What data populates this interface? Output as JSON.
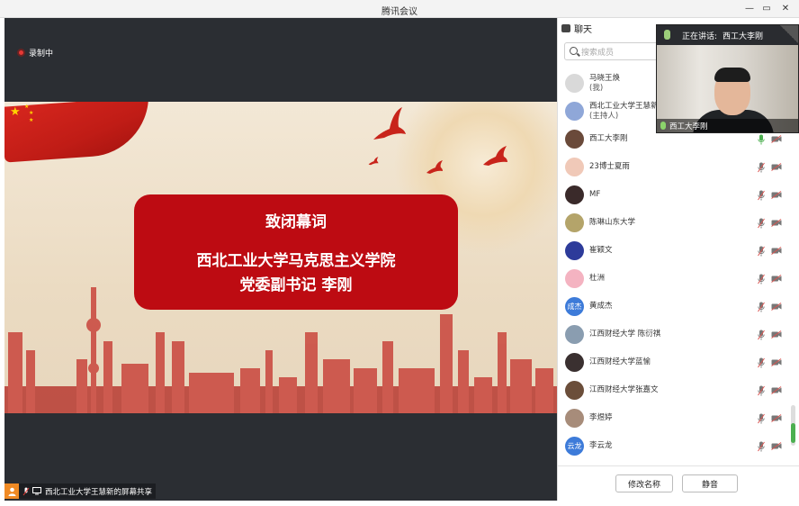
{
  "app": {
    "title": "腾讯会议"
  },
  "window_controls": {
    "minimize": "—",
    "restore": "▭",
    "close": "✕"
  },
  "recording": {
    "label": "录制中"
  },
  "slide": {
    "line1": "致闭幕词",
    "line2": "西北工业大学马克思主义学院",
    "line3": "党委副书记 李刚"
  },
  "share_status": {
    "text": "西北工业大学王慧新的屏幕共享"
  },
  "chat": {
    "tab_label": "聊天"
  },
  "search": {
    "placeholder": "搜索成员"
  },
  "speaker": {
    "prefix": "正在讲话:",
    "name": "西工大李刚",
    "video_label": "西工大李刚"
  },
  "members": [
    {
      "name": "马晓王焕",
      "sub": "(我)",
      "avatar_text": "",
      "avatar_color": "#d9d9d9",
      "mic": "none",
      "cam": "none"
    },
    {
      "name": "西北工业大学王慧新",
      "sub": "(主持人)",
      "avatar_text": "",
      "avatar_color": "#8fa7d8",
      "mic": "none",
      "cam": "none"
    },
    {
      "name": "西工大李刚",
      "sub": "",
      "avatar_text": "",
      "avatar_color": "#6a4a3a",
      "mic": "on",
      "cam": "off"
    },
    {
      "name": "23博士夏雨",
      "sub": "",
      "avatar_text": "",
      "avatar_color": "#f0c9b8",
      "mic": "off",
      "cam": "off"
    },
    {
      "name": "MF",
      "sub": "",
      "avatar_text": "",
      "avatar_color": "#3a2a2a",
      "mic": "off",
      "cam": "off"
    },
    {
      "name": "陈琳山东大学",
      "sub": "",
      "avatar_text": "",
      "avatar_color": "#b4a46a",
      "mic": "off",
      "cam": "off"
    },
    {
      "name": "崔颖文",
      "sub": "",
      "avatar_text": "",
      "avatar_color": "#2d3b9a",
      "mic": "off",
      "cam": "off"
    },
    {
      "name": "杜洲",
      "sub": "",
      "avatar_text": "",
      "avatar_color": "#f4b3c1",
      "mic": "off",
      "cam": "off"
    },
    {
      "name": "黄成杰",
      "sub": "",
      "avatar_text": "成杰",
      "avatar_color": "#3d7bd9",
      "mic": "off",
      "cam": "off"
    },
    {
      "name": "江西财经大学 陈衍祺",
      "sub": "",
      "avatar_text": "",
      "avatar_color": "#8a9db0",
      "mic": "off",
      "cam": "off"
    },
    {
      "name": "江西财经大学蓝愉",
      "sub": "",
      "avatar_text": "",
      "avatar_color": "#3a3030",
      "mic": "off",
      "cam": "off"
    },
    {
      "name": "江西财经大学张嘉文",
      "sub": "",
      "avatar_text": "",
      "avatar_color": "#6b4e3a",
      "mic": "off",
      "cam": "off"
    },
    {
      "name": "李煜婷",
      "sub": "",
      "avatar_text": "",
      "avatar_color": "#a78c7a",
      "mic": "off",
      "cam": "off"
    },
    {
      "name": "李云龙",
      "sub": "",
      "avatar_text": "云龙",
      "avatar_color": "#3d7bd9",
      "mic": "off",
      "cam": "off"
    }
  ],
  "buttons": {
    "rename": "修改名称",
    "mute": "静音"
  },
  "colors": {
    "accent_red": "#bd0b12",
    "mic_on": "#4caf50",
    "mic_off": "#d9534f"
  }
}
